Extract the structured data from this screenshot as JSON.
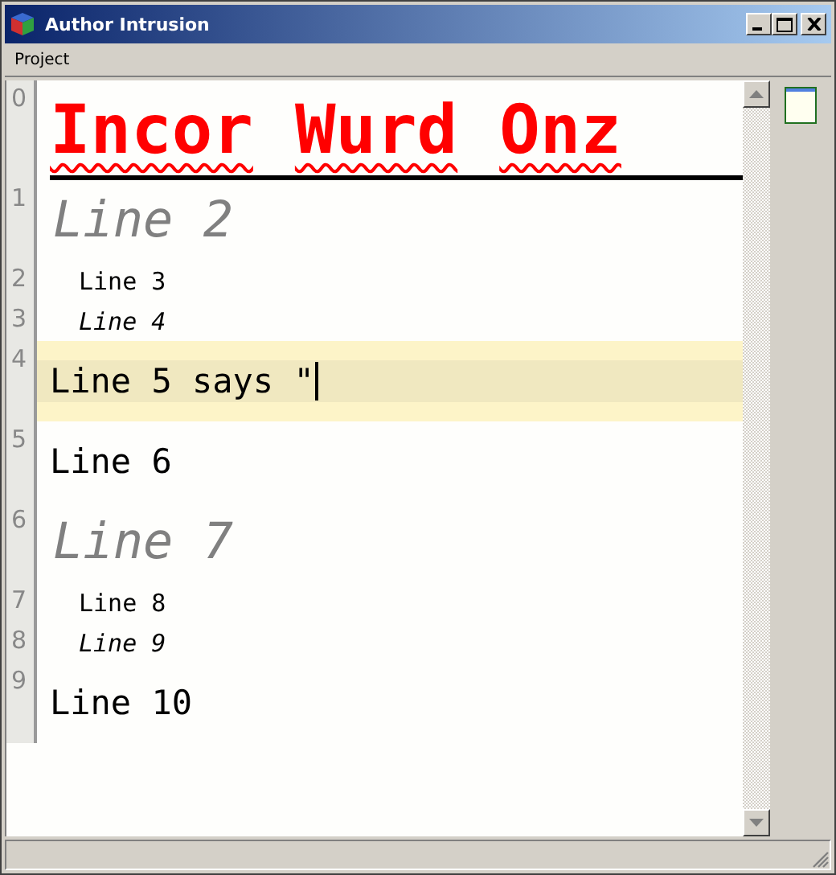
{
  "window": {
    "title": "Author Intrusion"
  },
  "menu": [
    {
      "label": "Project"
    }
  ],
  "lines": [
    {
      "number": "0",
      "kind": "chapter",
      "current": false,
      "words": [
        {
          "text": "Incor",
          "misspelled": true
        },
        {
          "text": "Wurd",
          "misspelled": true
        },
        {
          "text": "Onz",
          "misspelled": true
        }
      ]
    },
    {
      "number": "1",
      "kind": "heading",
      "current": false,
      "text": "Line 2"
    },
    {
      "number": "2",
      "kind": "small",
      "current": false,
      "text": "Line 3"
    },
    {
      "number": "3",
      "kind": "small-italic",
      "current": false,
      "text": "Line 4"
    },
    {
      "number": "4",
      "kind": "body",
      "current": true,
      "text": "Line 5 says \""
    },
    {
      "number": "5",
      "kind": "body",
      "current": false,
      "text": "Line 6"
    },
    {
      "number": "6",
      "kind": "heading",
      "current": false,
      "text": "Line 7"
    },
    {
      "number": "7",
      "kind": "small",
      "current": false,
      "text": "Line 8"
    },
    {
      "number": "8",
      "kind": "small-italic",
      "current": false,
      "text": "Line 9"
    },
    {
      "number": "9",
      "kind": "body",
      "current": false,
      "text": "Line 10"
    }
  ]
}
